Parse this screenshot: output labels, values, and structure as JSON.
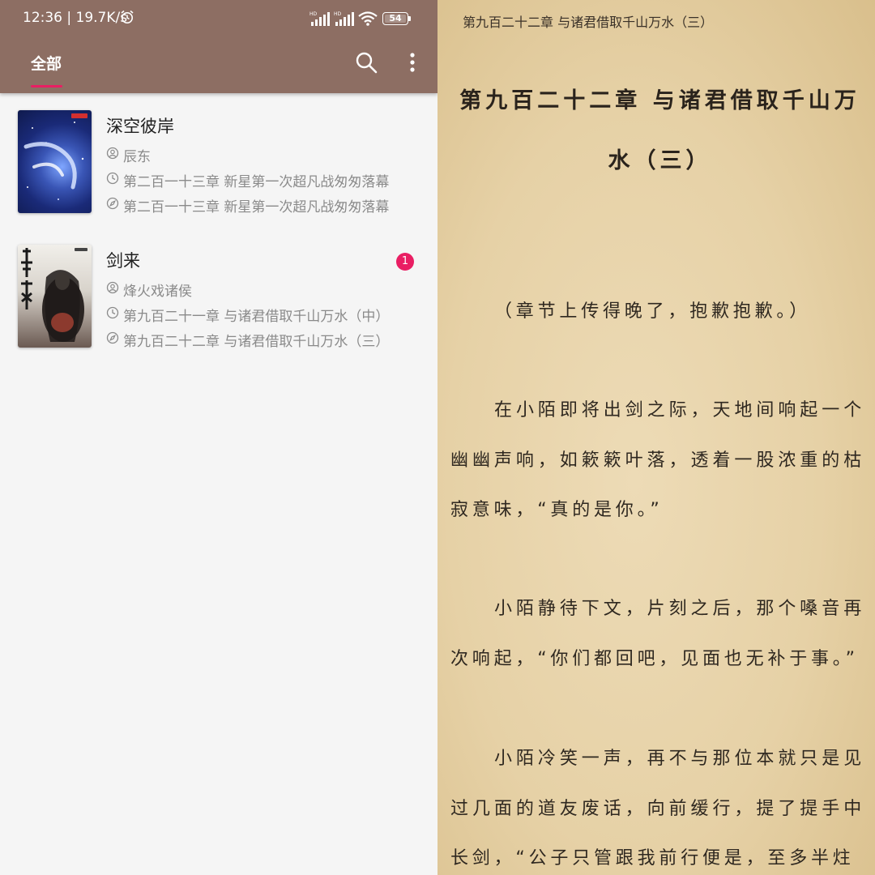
{
  "status_bar": {
    "time": "12:36 | 19.7K/s",
    "battery_level": "54",
    "sim1_label": "HD",
    "sim2_label": "HD"
  },
  "toolbar": {
    "tab_all": "全部",
    "search_icon": "search-icon",
    "more_icon": "more-vertical-icon"
  },
  "books": [
    {
      "title": "深空彼岸",
      "author": "辰东",
      "latest_chapter": "第二百一十三章 新星第一次超凡战匆匆落幕",
      "read_chapter": "第二百一十三章 新星第一次超凡战匆匆落幕",
      "unread_count": null,
      "cover_colors": [
        "#0f1a4d",
        "#3a56b6"
      ]
    },
    {
      "title": "剑来",
      "author": "烽火戏诸侯",
      "latest_chapter": "第九百二十一章 与诸君借取千山万水（中）",
      "read_chapter": "第九百二十二章 与诸君借取千山万水（三）",
      "unread_count": "1",
      "cover_colors": [
        "#e9e6e0",
        "#3a302c"
      ]
    }
  ],
  "reader": {
    "header": "第九百二十二章 与诸君借取千山万水（三）",
    "chapter_title": "第九百二十二章 与诸君借取千山万水（三）",
    "paragraphs": [
      "（章节上传得晚了，抱歉抱歉。）",
      "在小陌即将出剑之际，天地间响起一个幽幽声响，如簌簌叶落，透着一股浓重的枯寂意味，“真的是你。”",
      "小陌静待下文，片刻之后，那个嗓音再次响起，“你们都回吧，见面也无补于事。”",
      "小陌冷笑一声，再不与那位本就只是见过几面的道友废话，向前缓行，提了提手中长剑，“公子只管跟我前行便是，至多半炷"
    ]
  },
  "colors": {
    "toolbar": "#8d6e63",
    "accent": "#e91e63",
    "paper": "#e6d1a6"
  }
}
